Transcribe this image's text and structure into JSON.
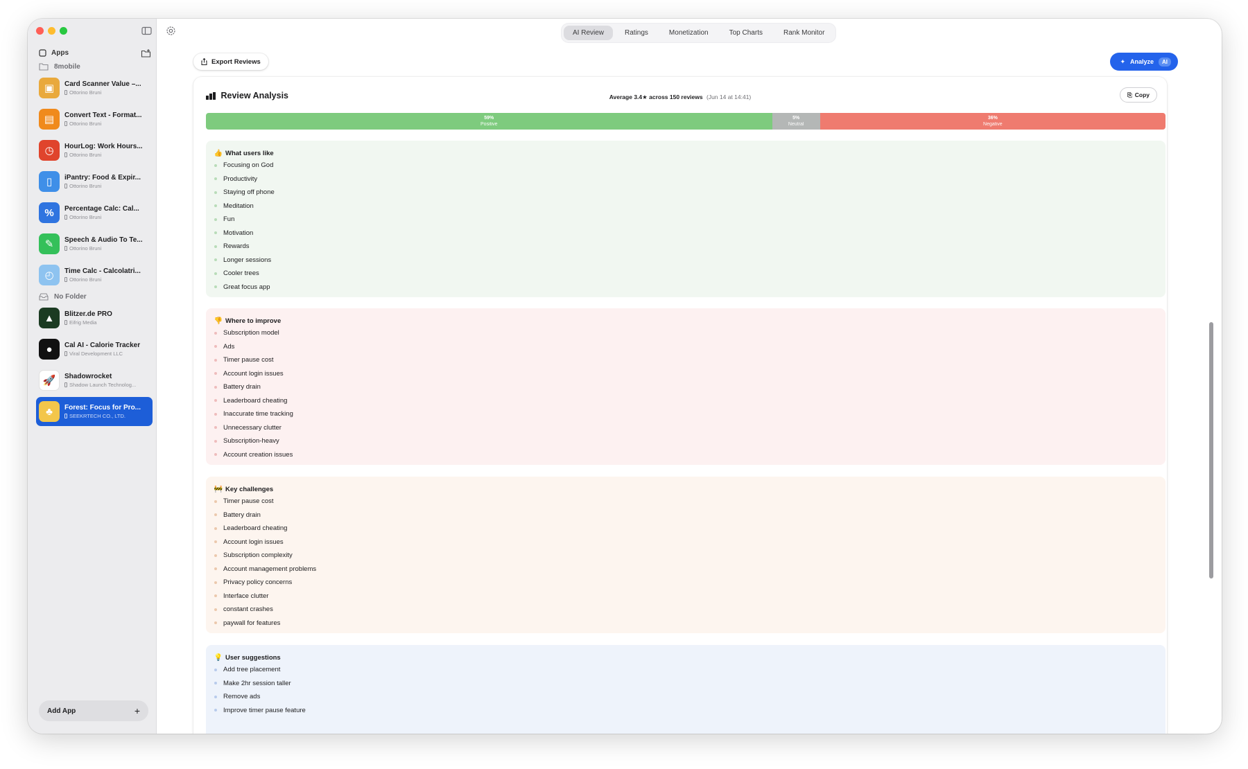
{
  "sidebar": {
    "apps_header": "Apps",
    "folders": [
      {
        "name": "8mobile",
        "apps": [
          {
            "title": "Card Scanner Value –...",
            "developer": "Ottorino Bruni",
            "icon_color": "#e9a93c",
            "glyph": "▣"
          },
          {
            "title": "Convert Text - Format...",
            "developer": "Ottorino Bruni",
            "icon_color": "#f08a1c",
            "glyph": "▤"
          },
          {
            "title": "HourLog: Work Hours...",
            "developer": "Ottorino Bruni",
            "icon_color": "#e0442c",
            "glyph": "◷"
          },
          {
            "title": "iPantry: Food & Expir...",
            "developer": "Ottorino Bruni",
            "icon_color": "#3f8fe8",
            "glyph": "▯"
          },
          {
            "title": "Percentage Calc: Cal...",
            "developer": "Ottorino Bruni",
            "icon_color": "#2f74e0",
            "glyph": "%"
          },
          {
            "title": "Speech & Audio To Te...",
            "developer": "Ottorino Bruni",
            "icon_color": "#34c05a",
            "glyph": "✎"
          },
          {
            "title": "Time Calc - Calcolatri...",
            "developer": "Ottorino Bruni",
            "icon_color": "#8ec3f0",
            "glyph": "◴"
          }
        ]
      },
      {
        "name": "No Folder",
        "apps": [
          {
            "title": "Blitzer.de PRO",
            "developer": "Eifrig Media",
            "icon_color": "#1b3b22",
            "glyph": "▲"
          },
          {
            "title": "Cal AI - Calorie Tracker",
            "developer": "Viral Development LLC",
            "icon_color": "#111111",
            "glyph": "●"
          },
          {
            "title": "Shadowrocket",
            "developer": "Shadow Launch Technolog...",
            "icon_color": "#ffffff",
            "glyph": "🚀"
          },
          {
            "title": "Forest: Focus for Pro...",
            "developer": "SEEKRTECH CO., LTD.",
            "icon_color": "#f3c64a",
            "glyph": "♣"
          }
        ]
      }
    ],
    "add_app_label": "Add App",
    "add_app_plus": "+"
  },
  "tabs": [
    "AI Review",
    "Ratings",
    "Monetization",
    "Top Charts",
    "Rank Monitor"
  ],
  "active_tab": "AI Review",
  "toolbar": {
    "export_label": "Export Reviews",
    "analyze_label": "Analyze",
    "analyze_badge": "AI"
  },
  "analysis": {
    "title": "Review Analysis",
    "summary": "Average 3.4★ across 150 reviews",
    "timestamp": "(Jun 14 at 14:41)",
    "copy_label": "Copy",
    "sentiment": [
      {
        "percent": 59,
        "text": "59%",
        "label": "Positive",
        "kind": "pos"
      },
      {
        "percent": 5,
        "text": "5%",
        "label": "Neutral",
        "kind": "neu"
      },
      {
        "percent": 36,
        "text": "36%",
        "label": "Negative",
        "kind": "neg"
      }
    ],
    "sections": [
      {
        "key": "like",
        "emoji": "👍",
        "title": "What users like",
        "items": [
          "Focusing on God",
          "Productivity",
          "Staying off phone",
          "Meditation",
          "Fun",
          "Motivation",
          "Rewards",
          "Longer sessions",
          "Cooler trees",
          "Great focus app"
        ]
      },
      {
        "key": "improve",
        "emoji": "👎",
        "title": "Where to improve",
        "items": [
          "Subscription model",
          "Ads",
          "Timer pause cost",
          "Account login issues",
          "Battery drain",
          "Leaderboard cheating",
          "Inaccurate time tracking",
          "Unnecessary clutter",
          "Subscription-heavy",
          "Account creation issues"
        ]
      },
      {
        "key": "challenge",
        "emoji": "🚧",
        "title": "Key challenges",
        "items": [
          "Timer pause cost",
          "Battery drain",
          "Leaderboard cheating",
          "Account login issues",
          "Subscription complexity",
          "Account management problems",
          "Privacy policy concerns",
          "Interface clutter",
          "constant crashes",
          "paywall for features"
        ]
      },
      {
        "key": "suggest",
        "emoji": "💡",
        "title": "User suggestions",
        "items": [
          "Add tree placement",
          "Make 2hr session taller",
          "Remove ads",
          "Improve timer pause feature"
        ]
      }
    ]
  }
}
